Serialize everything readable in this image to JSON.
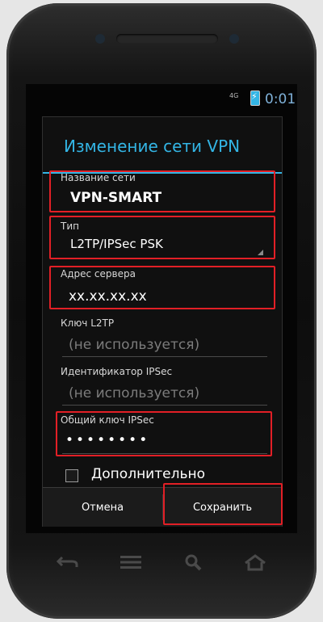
{
  "status_bar": {
    "network": "4G",
    "time": "0:01"
  },
  "dialog": {
    "title": "Изменение сети VPN",
    "fields": {
      "network_name": {
        "label": "Название сети",
        "value": "VPN-SMART"
      },
      "type": {
        "label": "Тип",
        "value": "L2TP/IPSec PSK"
      },
      "server_address": {
        "label": "Адрес сервера",
        "value": "xx.xx.xx.xx"
      },
      "l2tp_key": {
        "label": "Ключ L2TP",
        "placeholder": "(не используется)"
      },
      "ipsec_id": {
        "label": "Идентификатор IPSec",
        "placeholder": "(не используется)"
      },
      "ipsec_psk": {
        "label": "Общий ключ IPSec",
        "value": "••••••••"
      }
    },
    "advanced_label": "Дополнительно",
    "buttons": {
      "cancel": "Отмена",
      "save": "Сохранить"
    }
  },
  "navbar": {
    "icons": [
      "back-icon",
      "menu-icon",
      "search-icon",
      "home-icon"
    ]
  },
  "colors": {
    "accent": "#33b5e5",
    "highlight": "#e21f26"
  }
}
